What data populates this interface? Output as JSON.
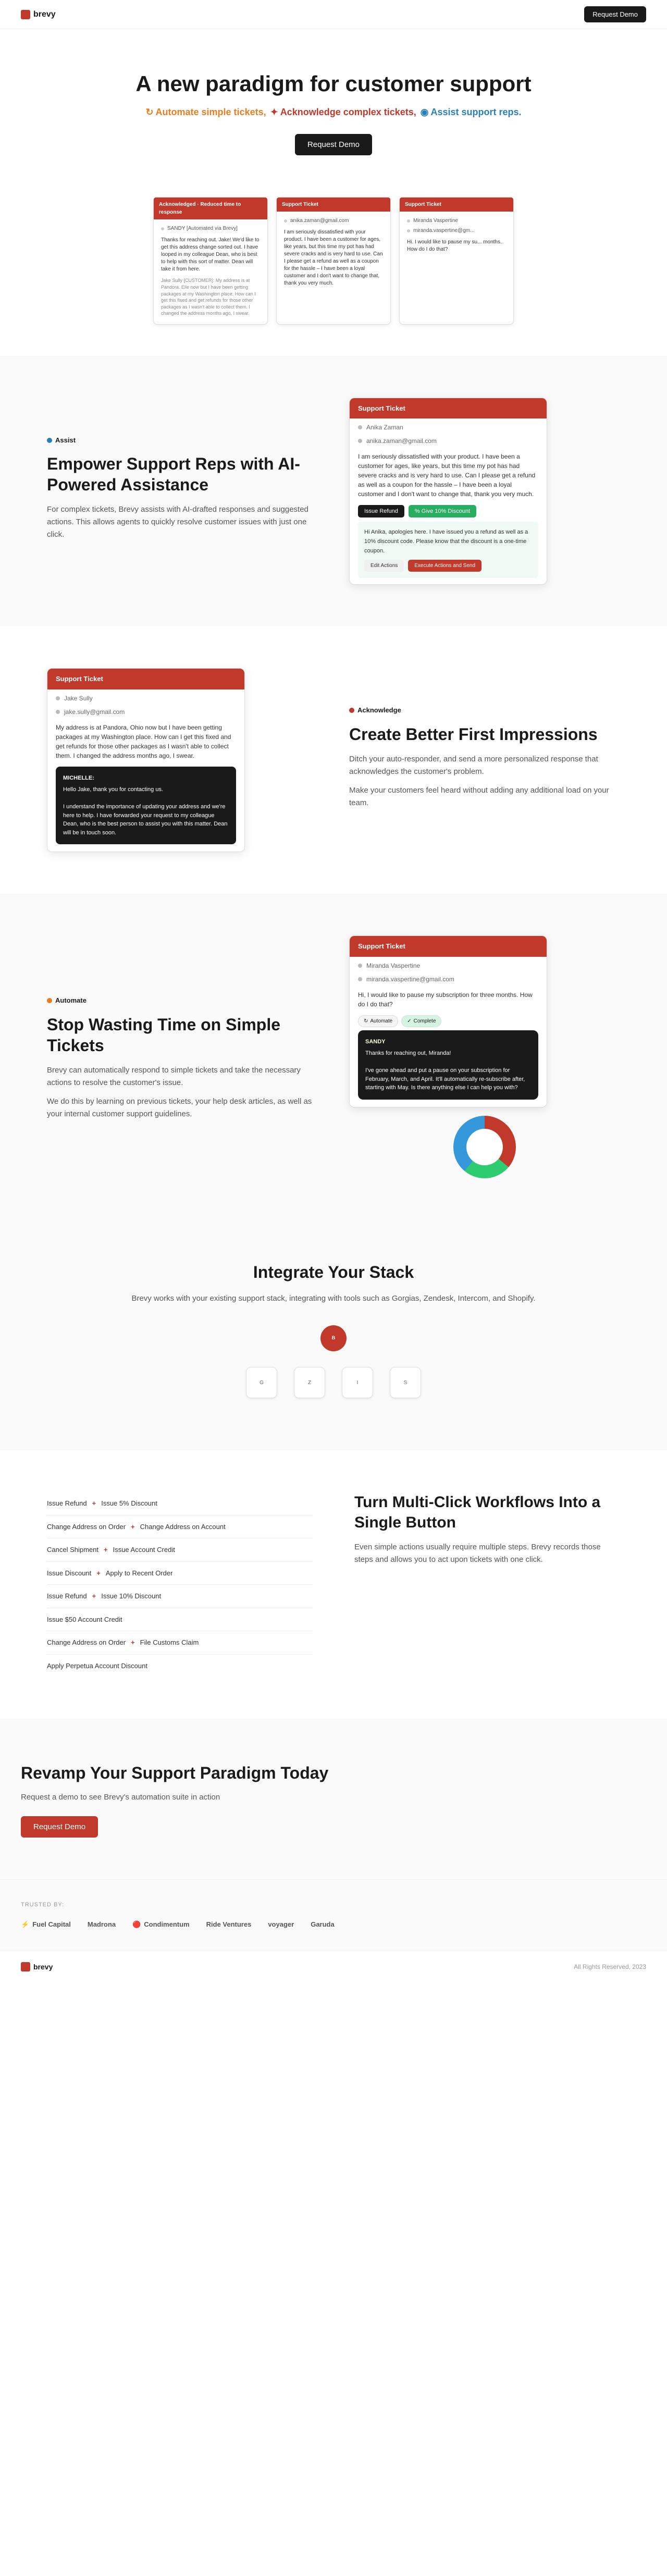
{
  "nav": {
    "logo": "brevy",
    "cta_label": "Request Demo"
  },
  "hero": {
    "title": "A new paradigm for customer support",
    "subtitle_prefix": "",
    "tag_automate": "Automate simple tickets,",
    "tag_acknowledge": "Acknowledge complex tickets,",
    "tag_assist": "Assist support reps.",
    "cta_label": "Request Demo"
  },
  "hero_cards": [
    {
      "id": "card1",
      "header": "Acknowledged · Reduced time to response",
      "sender": "SANDY [Automated via Brevy]",
      "body": "Thanks for reaching out. Jake! We'd like to get this address change sorted out. I have looped in my colleague Dean, who is best to help with this sort of matter. Dean will take it from here.",
      "sub": "Jake Sully [CUSTOMER]: My address is at Pandora. Elle now but I have been getting packages at my Washington place. How can I get this fixed and get refunds for those other packages as I wasn't able to collect them. I changed the address months ago, I swear."
    },
    {
      "id": "card2",
      "header": "Support Ticket",
      "sender_email": "anika.zaman@gmail.com",
      "body": "I am seriously dissatisfied with your product. I have been a customer for ages, like years, but this time my pot has had severe cracks and is very hard to use. Can I please get a refund as well as a coupon for the hassle – I have been a loyal customer and I don't want to change that, thank you very much."
    },
    {
      "id": "card3",
      "header": "Support Ticket",
      "sender": "Miranda Vaspertine",
      "sender_email": "miranda.vaspertine@gm...",
      "body": "Hi. I would like to pause my su... months. How do I do that?"
    }
  ],
  "assist_section": {
    "badge": "Assist",
    "title": "Empower Support Reps with AI-Powered Assistance",
    "body1": "For complex tickets, Brevy assists with AI-drafted responses and suggested actions. This allows agents to quickly resolve customer issues with just one click.",
    "ticket_header": "Support Ticket",
    "ticket_name": "Anika Zaman",
    "ticket_email": "anika.zaman@gmail.com",
    "ticket_body": "I am seriously dissatisfied with your product. I have been a customer for ages, like years, but this time my pot has had severe cracks and is very hard to use. Can I please get a refund as well as a coupon for the hassle – I have been a loyal customer and I don't want to change that, thank you very much.",
    "action_refund_label": "Issue Refund",
    "action_discount_label": "% Give 10% Discount",
    "response_intro": "Hi Anika, apologies here. I have issued you a refund as well as a 10% discount code. Please know that the discount is a one-time coupon.",
    "btn_edit": "Edit Actions",
    "btn_execute": "Execute Actions and Send"
  },
  "acknowledge_section": {
    "badge": "Acknowledge",
    "title": "Create Better First Impressions",
    "body1": "Ditch your auto-responder, and send a more personalized response that acknowledges the customer's problem.",
    "body2": "Make your customers feel heard without adding any additional load on your team.",
    "ticket_header": "Support Ticket",
    "ticket_name": "Jake Sully",
    "ticket_email": "jake.sully@gmail.com",
    "ticket_body": "My address is at Pandora, Ohio now but I have been getting packages at my Washington place. How can I get this fixed and get refunds for those other packages as I wasn't able to collect them. I changed the address months ago, I swear.",
    "ai_name": "MICHELLE:",
    "ai_body": "Hello Jake, thank you for contacting us.\n\nI understand the importance of updating your address and we're here to help. I have forwarded your request to my colleague Dean, who is the best person to assist you with this matter. Dean will be in touch soon."
  },
  "automate_section": {
    "badge": "Automate",
    "title": "Stop Wasting Time on Simple Tickets",
    "body1": "Brevy can automatically respond to simple tickets and take the necessary actions to resolve the customer's issue.",
    "body2": "We do this by learning on previous tickets, your help desk articles, as well as your internal customer support guidelines.",
    "ticket_header": "Support Ticket",
    "ticket_name": "Miranda Vaspertine",
    "ticket_email": "miranda.vaspertine@gmail.com",
    "ticket_body": "Hi, I would like to pause my subscription for three months. How do I do that?",
    "ai_tags": [
      "Automate",
      "Complete"
    ],
    "response_sender": "SANDY",
    "response_body": "Thanks for reaching out, Miranda!\n\nI've gone ahead and put a pause on your subscription for February, March, and April. It'll automatically re-subscribe after, starting with May. Is there anything else I can help you with?"
  },
  "integrate_section": {
    "title": "Integrate Your Stack",
    "body": "Brevy works with your existing support stack, integrating with tools such as Gorgias, Zendesk, Intercom, and Shopify.",
    "logos": [
      "Gorgias",
      "Zendesk",
      "Intercom",
      "Shopify"
    ]
  },
  "workflows_section": {
    "title": "Turn Multi-Click Workflows Into a Single Button",
    "body": "Even simple actions usually require multiple steps. Brevy records those steps and allows you to act upon tickets with one click.",
    "items": [
      {
        "left": "Issue Refund",
        "arrow": "+",
        "right": "Issue 5% Discount"
      },
      {
        "left": "Change Address on Order",
        "arrow": "+",
        "right": "Change Address on Account"
      },
      {
        "left": "Cancel Shipment",
        "arrow": "+",
        "right": "Issue Account Credit"
      },
      {
        "left": "Issue Discount",
        "arrow": "+",
        "right": "Apply to Recent Order"
      },
      {
        "left": "Issue Refund",
        "arrow": "+",
        "right": "Issue 10% Discount"
      },
      {
        "left": "Issue $50 Account Credit",
        "arrow": "",
        "right": ""
      },
      {
        "left": "Change Address on Order",
        "arrow": "+",
        "right": "File Customs Claim"
      },
      {
        "left": "Apply Perpetua Account Discount",
        "arrow": "",
        "right": ""
      }
    ]
  },
  "cta_section": {
    "title": "Revamp Your Support Paradigm Today",
    "body": "Request a demo to see Brevy's automation suite in action",
    "cta_label": "Request Demo",
    "trusted_label": "Trusted by:",
    "logos": [
      "Fuel Capital",
      "Madrona",
      "Condimentum",
      "Ride Ventures",
      "voyager",
      "Garuda"
    ]
  },
  "footer": {
    "logo": "brevy",
    "copyright": "All Rights Reserved, 2023"
  }
}
